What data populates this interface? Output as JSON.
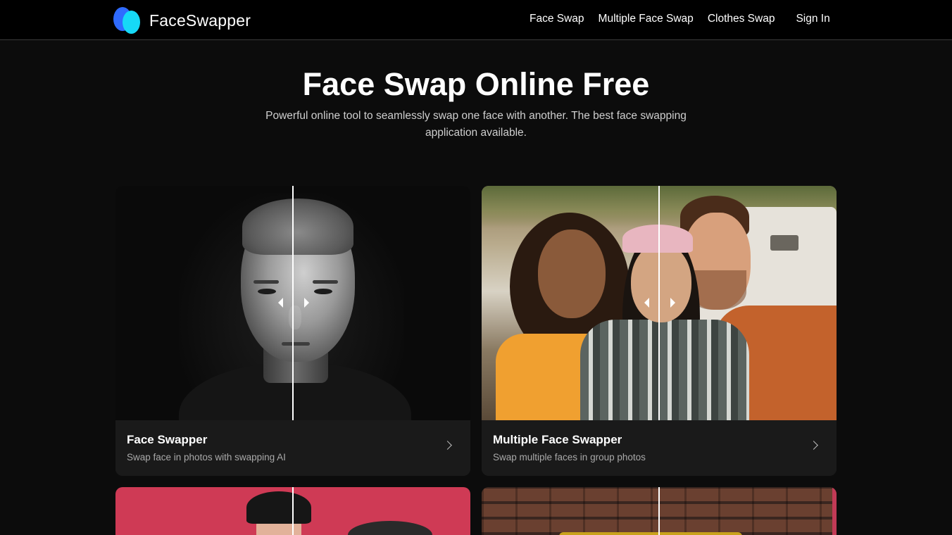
{
  "brand": {
    "name": "FaceSwapper",
    "logo_colors": [
      "#2f6bff",
      "#16d9f7"
    ]
  },
  "nav": {
    "items": [
      {
        "label": "Face Swap"
      },
      {
        "label": "Multiple Face Swap"
      },
      {
        "label": "Clothes Swap"
      }
    ],
    "sign_in": "Sign In"
  },
  "hero": {
    "title": "Face Swap Online Free",
    "subtitle": "Powerful online tool to seamlessly swap one face with another. The best face swapping application available."
  },
  "cards": [
    {
      "title": "Face Swapper",
      "description": "Swap face in photos with swapping AI",
      "icon": "chevron-right-icon"
    },
    {
      "title": "Multiple Face Swapper",
      "description": "Swap multiple faces in group photos",
      "icon": "chevron-right-icon"
    }
  ],
  "colors": {
    "background": "#0c0c0c",
    "header_bg": "#000000",
    "card_bg": "#1a1a1a",
    "muted_text": "#a9a9a9"
  }
}
